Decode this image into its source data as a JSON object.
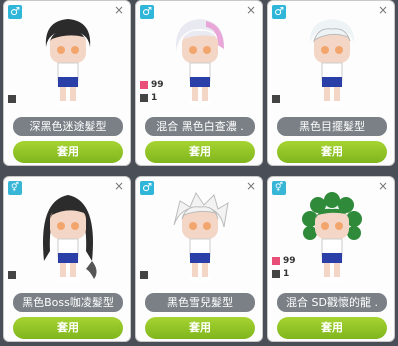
{
  "cards": [
    {
      "gender": "♂",
      "name": "深黑色迷途髮型",
      "use_label": "套用"
    },
    {
      "gender": "♂",
      "name": "混合 黑色白查濃 .",
      "qty_pink": "99",
      "qty_dark": "1",
      "use_label": "套用"
    },
    {
      "gender": "♂",
      "name": "黑色目擺髮型",
      "use_label": "套用"
    },
    {
      "gender": "⚥",
      "name": "黑色Boss咖凌髮型",
      "use_label": "套用"
    },
    {
      "gender": "♂",
      "name": "黑色雪兒髮型",
      "use_label": "套用"
    },
    {
      "gender": "⚥",
      "name": "混合 SD戳懷的龍 .",
      "qty_pink": "99",
      "qty_dark": "1",
      "use_label": "套用"
    }
  ],
  "close_icon": "×",
  "colors": {
    "button": "#8fc428",
    "name_bar": "#7a8086",
    "male": "#2fb6d8",
    "quantity_pink": "#e8507a"
  }
}
